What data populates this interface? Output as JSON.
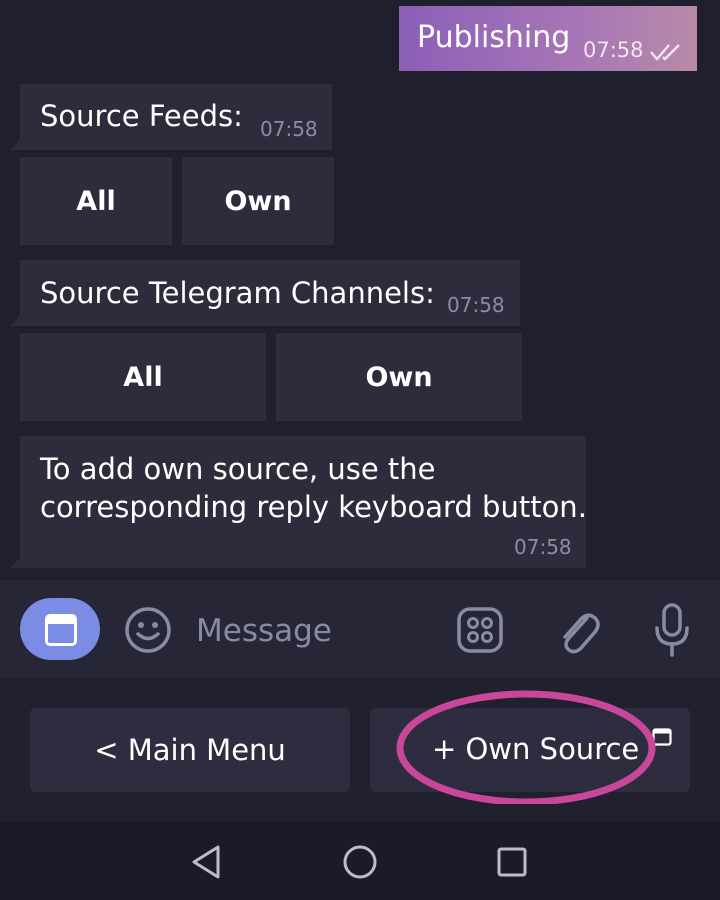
{
  "chat": {
    "outgoing": {
      "text": "Publishing",
      "time": "07:58"
    },
    "messages": [
      {
        "text": "Source Feeds:",
        "time": "07:58",
        "buttons": [
          "All",
          "Own"
        ]
      },
      {
        "text": "Source Telegram Channels:",
        "time": "07:58",
        "buttons": [
          "All",
          "Own"
        ]
      },
      {
        "text_lines": [
          "To add own source, use the",
          "corresponding reply keyboard button."
        ],
        "time": "07:58"
      }
    ]
  },
  "input": {
    "placeholder": "Message"
  },
  "reply_keyboard": {
    "buttons": [
      "< Main Menu",
      "+ Own Source"
    ]
  },
  "colors": {
    "background": "#1f1f2e",
    "bubble": "#2c2c3d",
    "outgoing_gradient": "#8b5fb8",
    "accent": "#7b8ce4",
    "annotation": "#c9479a"
  },
  "icons": [
    "read-ticks-icon",
    "keyboard-toggle-icon",
    "emoji-icon",
    "sticker-icon",
    "attach-icon",
    "mic-icon",
    "back-nav-icon",
    "home-nav-icon",
    "recents-nav-icon"
  ]
}
